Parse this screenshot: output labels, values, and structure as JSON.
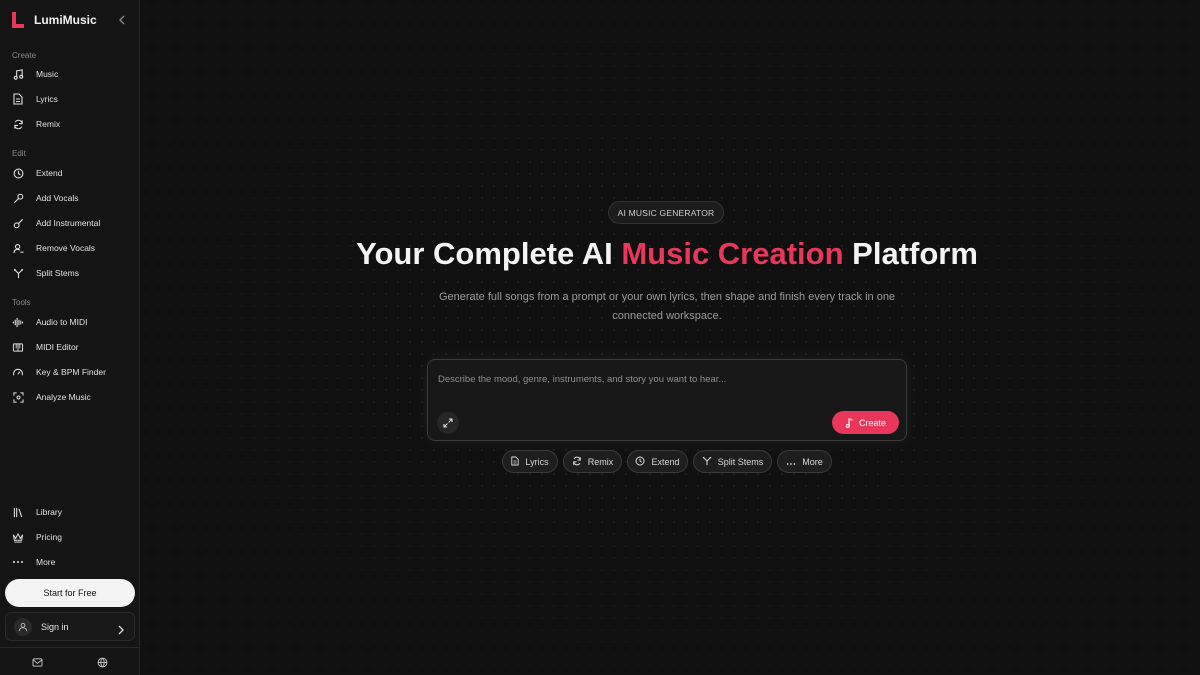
{
  "app": {
    "name": "LumiMusic",
    "accent": "#e8375a"
  },
  "sidebar": {
    "sections": [
      {
        "label": "Create",
        "items": [
          {
            "label": "Music",
            "icon": "music-note-icon"
          },
          {
            "label": "Lyrics",
            "icon": "document-icon"
          },
          {
            "label": "Remix",
            "icon": "refresh-icon"
          }
        ]
      },
      {
        "label": "Edit",
        "items": [
          {
            "label": "Extend",
            "icon": "clock-icon"
          },
          {
            "label": "Add Vocals",
            "icon": "microphone-icon"
          },
          {
            "label": "Add Instrumental",
            "icon": "guitar-icon"
          },
          {
            "label": "Remove Vocals",
            "icon": "user-minus-icon"
          },
          {
            "label": "Split Stems",
            "icon": "split-icon"
          }
        ]
      },
      {
        "label": "Tools",
        "items": [
          {
            "label": "Audio to MIDI",
            "icon": "waveform-icon"
          },
          {
            "label": "MIDI Editor",
            "icon": "piano-icon"
          },
          {
            "label": "Key & BPM Finder",
            "icon": "gauge-icon"
          },
          {
            "label": "Analyze Music",
            "icon": "scan-icon"
          }
        ]
      }
    ],
    "bottom_items": [
      {
        "label": "Library",
        "icon": "library-icon"
      },
      {
        "label": "Pricing",
        "icon": "crown-icon"
      },
      {
        "label": "More",
        "icon": "dots-icon"
      }
    ],
    "start_label": "Start for Free",
    "signin_label": "Sign in"
  },
  "hero": {
    "badge": "AI MUSIC GENERATOR",
    "title_before": "Your Complete AI ",
    "title_accent": "Music Creation",
    "title_after": " Platform",
    "subtitle": "Generate full songs from a prompt or your own lyrics, then shape and finish every track in one connected workspace."
  },
  "prompt": {
    "placeholder": "Describe the mood, genre, instruments, and story you want to hear...",
    "value": "",
    "create_label": "Create"
  },
  "chips": [
    {
      "label": "Lyrics",
      "icon": "document-icon"
    },
    {
      "label": "Remix",
      "icon": "refresh-icon"
    },
    {
      "label": "Extend",
      "icon": "clock-icon"
    },
    {
      "label": "Split Stems",
      "icon": "split-icon"
    },
    {
      "label": "More",
      "icon": "dots-icon"
    }
  ]
}
